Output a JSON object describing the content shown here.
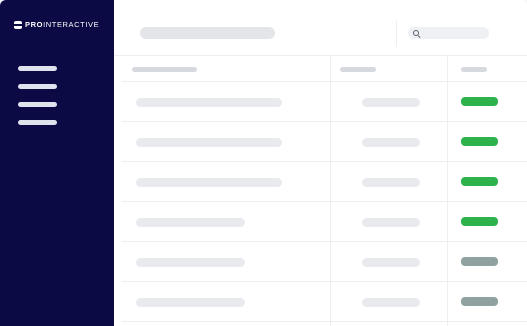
{
  "brand": {
    "bold": "PRO",
    "light": "INTERACTIVE",
    "icon": "brand-logo-icon"
  },
  "sidebar": {
    "items": [
      {
        "id": "nav-1"
      },
      {
        "id": "nav-2"
      },
      {
        "id": "nav-3"
      },
      {
        "id": "nav-4"
      }
    ]
  },
  "search": {
    "icon": "search-icon",
    "placeholder": ""
  },
  "colors": {
    "sidebar": "#0b0a45",
    "active": "#2eb24c",
    "inactive": "#8fa29f",
    "skeleton": "#e8eaed"
  },
  "table": {
    "rows": [
      {
        "status": "active"
      },
      {
        "status": "active"
      },
      {
        "status": "active"
      },
      {
        "status": "active"
      },
      {
        "status": "inactive"
      },
      {
        "status": "inactive"
      }
    ]
  }
}
